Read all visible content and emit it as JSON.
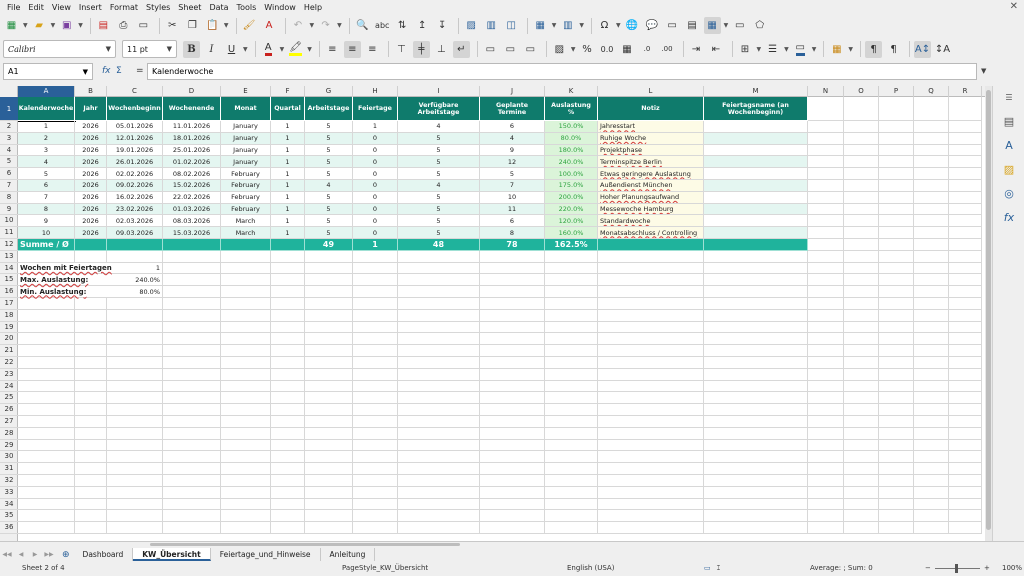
{
  "menu": [
    "File",
    "Edit",
    "View",
    "Insert",
    "Format",
    "Styles",
    "Sheet",
    "Data",
    "Tools",
    "Window",
    "Help"
  ],
  "font": {
    "name": "Calibri",
    "size": "11 pt"
  },
  "formula_bar": {
    "cell_ref": "A1",
    "fx": "fx",
    "sigma": "Σ",
    "equals": "=",
    "content": "Kalenderwoche"
  },
  "columns": [
    "A",
    "B",
    "C",
    "D",
    "E",
    "F",
    "G",
    "H",
    "I",
    "J",
    "K",
    "L",
    "M",
    "N",
    "O",
    "P",
    "Q",
    "R"
  ],
  "header_row": [
    "Kalenderwoche",
    "Jahr",
    "Wochenbeginn",
    "Wochenende",
    "Monat",
    "Quartal",
    "Arbeitstage",
    "Feiertage",
    "Verfügbare Arbeitstage",
    "Geplante Termine",
    "Auslastung %",
    "Notiz",
    "Feiertagsname (an Wochenbeginn)"
  ],
  "rows": [
    [
      "1",
      "2026",
      "05.01.2026",
      "11.01.2026",
      "January",
      "1",
      "5",
      "1",
      "4",
      "6",
      "150.0%",
      "Jahresstart",
      ""
    ],
    [
      "2",
      "2026",
      "12.01.2026",
      "18.01.2026",
      "January",
      "1",
      "5",
      "0",
      "5",
      "4",
      "80.0%",
      "Ruhige Woche",
      ""
    ],
    [
      "3",
      "2026",
      "19.01.2026",
      "25.01.2026",
      "January",
      "1",
      "5",
      "0",
      "5",
      "9",
      "180.0%",
      "Projektphase",
      ""
    ],
    [
      "4",
      "2026",
      "26.01.2026",
      "01.02.2026",
      "January",
      "1",
      "5",
      "0",
      "5",
      "12",
      "240.0%",
      "Terminspitze Berlin",
      ""
    ],
    [
      "5",
      "2026",
      "02.02.2026",
      "08.02.2026",
      "February",
      "1",
      "5",
      "0",
      "5",
      "5",
      "100.0%",
      "Etwas geringere Auslastung",
      ""
    ],
    [
      "6",
      "2026",
      "09.02.2026",
      "15.02.2026",
      "February",
      "1",
      "4",
      "0",
      "4",
      "7",
      "175.0%",
      "Außendienst München",
      ""
    ],
    [
      "7",
      "2026",
      "16.02.2026",
      "22.02.2026",
      "February",
      "1",
      "5",
      "0",
      "5",
      "10",
      "200.0%",
      "Hoher Planungsaufwand",
      ""
    ],
    [
      "8",
      "2026",
      "23.02.2026",
      "01.03.2026",
      "February",
      "1",
      "5",
      "0",
      "5",
      "11",
      "220.0%",
      "Messewoche Hamburg",
      ""
    ],
    [
      "9",
      "2026",
      "02.03.2026",
      "08.03.2026",
      "March",
      "1",
      "5",
      "0",
      "5",
      "6",
      "120.0%",
      "Standardwoche",
      ""
    ],
    [
      "10",
      "2026",
      "09.03.2026",
      "15.03.2026",
      "March",
      "1",
      "5",
      "0",
      "5",
      "8",
      "160.0%",
      "Monatsabschluss / Controlling",
      ""
    ]
  ],
  "sum_row": {
    "label": "Summe / Ø",
    "arbeitstage": "49",
    "feiertage": "1",
    "verfuegbar": "48",
    "termine": "78",
    "auslastung": "162.5%"
  },
  "stats": [
    {
      "label": "Wochen mit Feiertagen",
      "value": "1"
    },
    {
      "label": "Max. Auslastung:",
      "value": "240.0%"
    },
    {
      "label": "Min. Auslastung:",
      "value": "80.0%"
    }
  ],
  "tabs": [
    "Dashboard",
    "KW_Übersicht",
    "Feiertage_und_Hinweise",
    "Anleitung"
  ],
  "active_tab": "KW_Übersicht",
  "status": {
    "sheet": "Sheet 2 of 4",
    "page_style": "PageStyle_KW_Übersicht",
    "language": "English (USA)",
    "summary": "Average: ; Sum: 0",
    "zoom": "100%"
  },
  "colors": {
    "header": "#0f7b6c",
    "sum": "#1fb39c",
    "accent": "#2a6099"
  }
}
